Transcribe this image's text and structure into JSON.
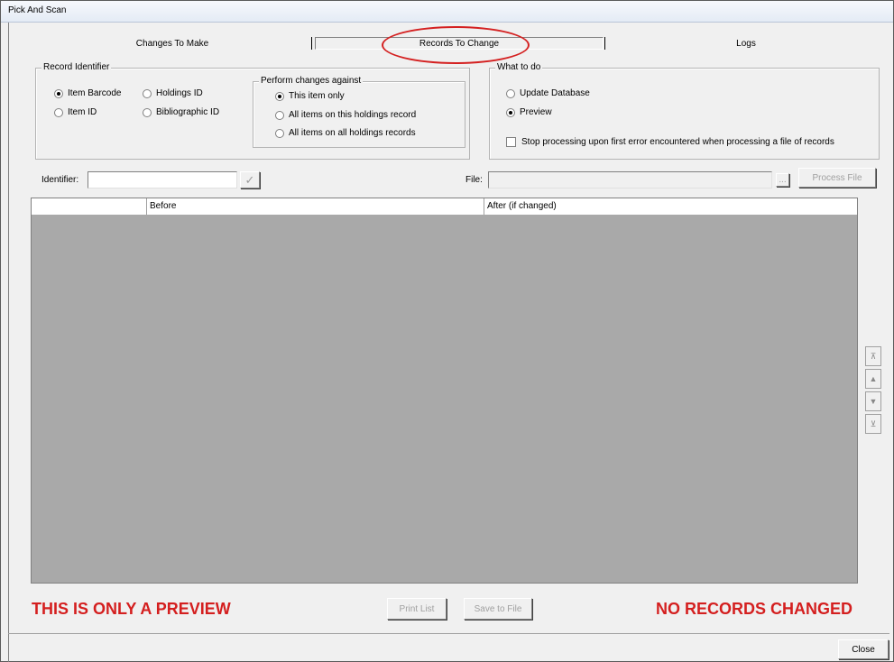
{
  "window": {
    "title": "Pick And Scan"
  },
  "tabs": [
    {
      "label": "Changes To Make"
    },
    {
      "label": "Records To Change"
    },
    {
      "label": "Logs"
    }
  ],
  "record_identifier": {
    "title": "Record Identifier",
    "options": [
      "Item Barcode",
      "Holdings ID",
      "Item ID",
      "Bibliographic ID"
    ],
    "selected": "Item Barcode"
  },
  "perform_changes": {
    "title": "Perform changes against",
    "options": [
      "This item only",
      "All items on this holdings record",
      "All items on all holdings records"
    ],
    "selected": "This item only"
  },
  "what_to_do": {
    "title": "What to do",
    "options": [
      "Update Database",
      "Preview"
    ],
    "selected": "Preview",
    "stop_on_error_label": "Stop processing upon first error encountered when processing a file of records"
  },
  "identifier": {
    "label": "Identifier:",
    "value": "",
    "check_icon": "checkmark-icon"
  },
  "file": {
    "label": "File:",
    "value": "",
    "browse_label": "...",
    "process_button": "Process File"
  },
  "grid": {
    "columns": [
      "",
      "Before",
      "After (if changed)"
    ],
    "rows": []
  },
  "nav": {
    "icons": [
      "first-icon",
      "up-icon",
      "down-icon",
      "last-icon"
    ]
  },
  "footer": {
    "preview_notice": "THIS IS ONLY A PREVIEW",
    "no_change_notice": "NO RECORDS CHANGED",
    "print_list": "Print List",
    "save_to_file": "Save to File",
    "close": "Close"
  },
  "colors": {
    "alert_red": "#d41f1f",
    "grid_bg": "#a9a9a9",
    "window_bg": "#f0f0f0"
  }
}
